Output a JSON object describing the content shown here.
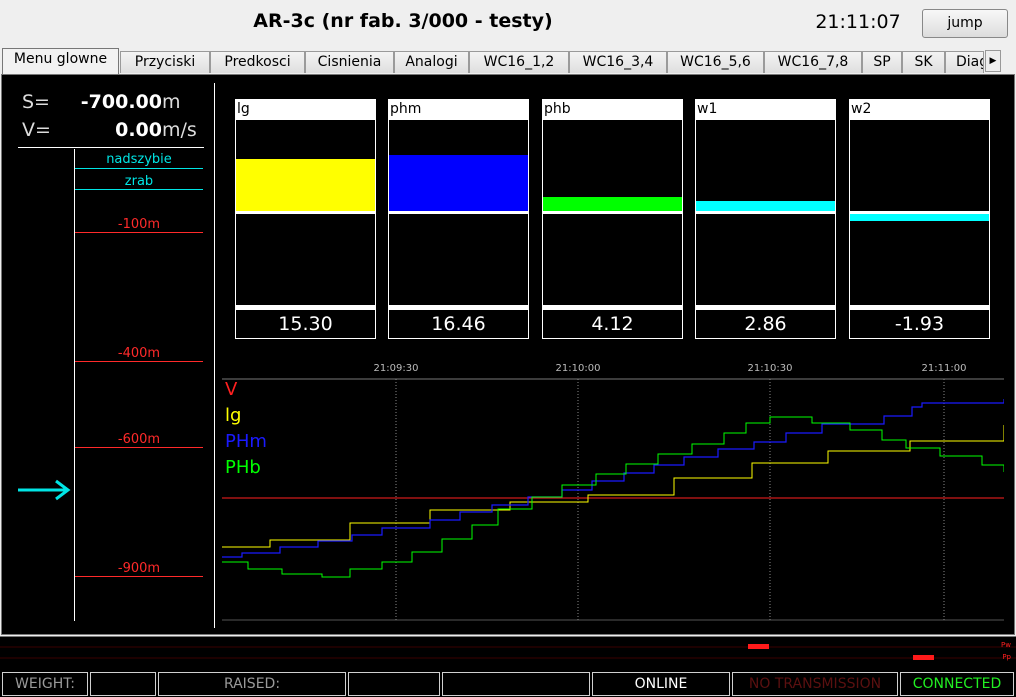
{
  "header": {
    "title": "AR-3c (nr fab. 3/000 - testy)",
    "time": "21:11:07",
    "jump_label": "jump"
  },
  "tabs": [
    "Menu glowne",
    "Przyciski",
    "Predkosci",
    "Cisnienia",
    "Analogi",
    "WC16_1,2",
    "WC16_3,4",
    "WC16_5,6",
    "WC16_7,8",
    "SP",
    "SK",
    "Diagn"
  ],
  "active_tab": "Menu glowne",
  "position": {
    "s_label": "S=",
    "s_value": "-700.00",
    "s_unit": "m",
    "v_label": "V=",
    "v_value": "0.00",
    "v_unit": "m/s"
  },
  "shaft": {
    "levels": [
      {
        "name": "nadszybie",
        "color": "#00e5e5"
      },
      {
        "name": "zrab",
        "color": "#00e5e5"
      },
      {
        "name": "-100m",
        "color": "#ff2a2a"
      },
      {
        "name": "-400m",
        "color": "#ff2a2a"
      },
      {
        "name": "-600m",
        "color": "#ff2a2a"
      },
      {
        "name": "-900m",
        "color": "#ff2a2a"
      }
    ],
    "arrow_color": "#00e5e5"
  },
  "gauges": [
    {
      "name": "lg",
      "value": "15.30",
      "color": "#ffff00",
      "level": 15.3
    },
    {
      "name": "phm",
      "value": "16.46",
      "color": "#0000ff",
      "level": 16.46
    },
    {
      "name": "phb",
      "value": "4.12",
      "color": "#00ff00",
      "level": 4.12
    },
    {
      "name": "w1",
      "value": "2.86",
      "color": "#00ffff",
      "level": 2.86
    },
    {
      "name": "w2",
      "value": "-1.93",
      "color": "#00ffff",
      "level": -1.93
    }
  ],
  "chart_data": {
    "type": "line",
    "x_ticks": [
      "21:09:30",
      "21:10:00",
      "21:10:30",
      "21:11:00"
    ],
    "series": [
      {
        "name": "V",
        "color": "#ff2020"
      },
      {
        "name": "lg",
        "color": "#ffff00"
      },
      {
        "name": "PHm",
        "color": "#1a1aff"
      },
      {
        "name": "PHb",
        "color": "#00ff00"
      }
    ]
  },
  "strip": {
    "label_top": "Pw",
    "label_bottom": "Pp"
  },
  "status": {
    "weight_label": "WEIGHT:",
    "weight_value": "",
    "raised_label": "RAISED:",
    "raised_value": "",
    "online": "ONLINE",
    "no_transmission": "NO TRANSMISSION",
    "connected": "CONNECTED",
    "colors": {
      "online": "#ffffff",
      "no_transmission": "#5a1010",
      "connected": "#22ee22",
      "label": "#9a9a9a"
    }
  }
}
